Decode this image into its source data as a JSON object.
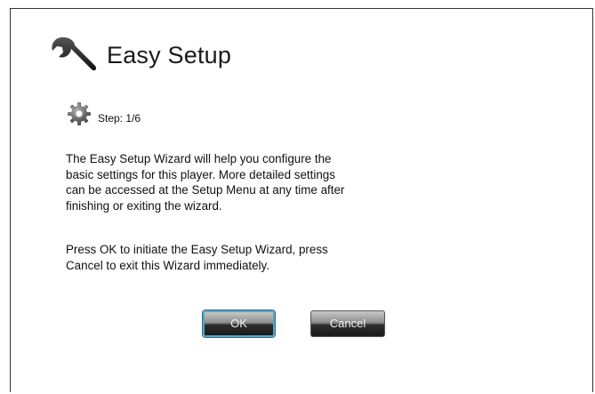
{
  "header": {
    "title": "Easy Setup",
    "icon": "wrench-icon"
  },
  "step": {
    "icon": "gear-icon",
    "label": "Step: 1/6"
  },
  "body": {
    "paragraph_1": "The Easy Setup Wizard will help you configure the\nbasic settings for this player.  More detailed settings\ncan be accessed at the Setup Menu at any time after\nfinishing or exiting the wizard.",
    "paragraph_2": "Press OK to initiate the Easy Setup Wizard, press\nCancel to exit this Wizard immediately."
  },
  "buttons": {
    "ok_label": "OK",
    "cancel_label": "Cancel",
    "focused": "OK"
  },
  "colors": {
    "focus_border": "#5aa6c4",
    "button_dark": "#1a1a1a"
  }
}
